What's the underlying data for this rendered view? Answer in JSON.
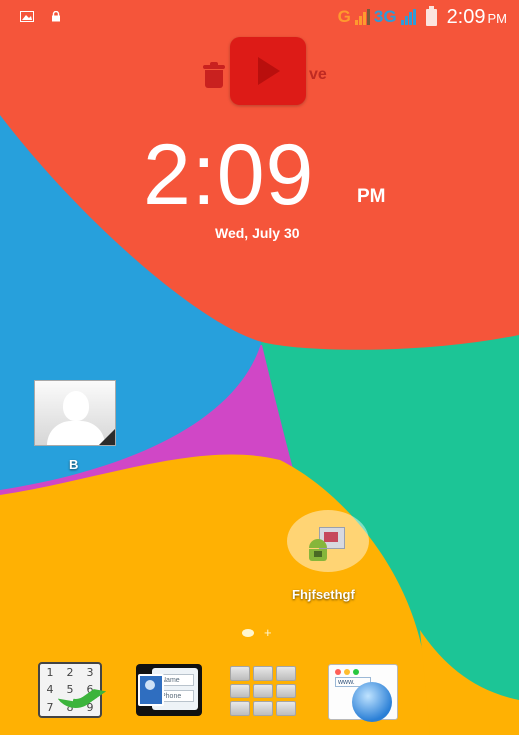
{
  "statusbar": {
    "network_g": "G",
    "network_3g": "3G",
    "time": "2:09",
    "ampm": "PM"
  },
  "drag_hint": {
    "text": "ve"
  },
  "clock": {
    "time": "2:09",
    "ampm": "PM",
    "date": "Wed, July 30"
  },
  "desktop": {
    "contact_shortcut_label": "B",
    "app_shortcut_label": "Fhjfsethgf"
  },
  "pager": {
    "pages": 2,
    "current_page": 1
  },
  "dock": {
    "dialer_keys": [
      "1",
      "2",
      "3",
      "4",
      "5",
      "6",
      "7",
      "8",
      "9"
    ],
    "contacts_fields": [
      "Name",
      "Phone"
    ],
    "browser_url": "www."
  },
  "colors": {
    "wallpaper_red": "#f5553a",
    "wallpaper_blue": "#27a0dc",
    "wallpaper_teal": "#1cc596",
    "wallpaper_magenta": "#d047c6",
    "wallpaper_yellow": "#ffb103",
    "network_orange": "#ff9a2e",
    "network_blue": "#2f9bd7",
    "trash_red": "#c9211f",
    "youtube_red": "#dd1b17"
  }
}
